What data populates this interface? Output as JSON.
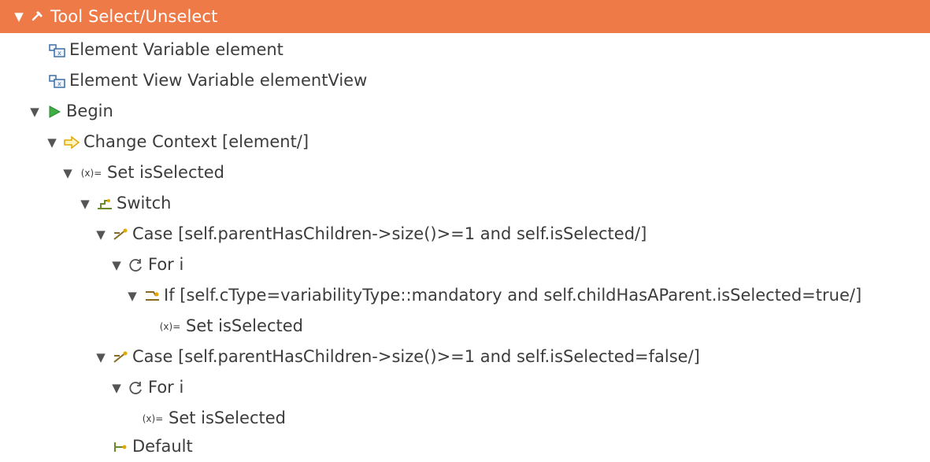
{
  "tree": {
    "root": {
      "label": "Tool Select/Unselect"
    },
    "items": [
      {
        "label": "Element Variable element"
      },
      {
        "label": "Element View Variable elementView"
      },
      {
        "label": "Begin"
      },
      {
        "label": "Change Context [element/]"
      },
      {
        "label": "Set isSelected"
      },
      {
        "label": "Switch"
      },
      {
        "label": "Case [self.parentHasChildren->size()>=1 and self.isSelected/]"
      },
      {
        "label": "For i"
      },
      {
        "label": "If [self.cType=variabilityType::mandatory and self.childHasAParent.isSelected=true/]"
      },
      {
        "label": "Set isSelected"
      },
      {
        "label": "Case [self.parentHasChildren->size()>=1 and self.isSelected=false/]"
      },
      {
        "label": "For i"
      },
      {
        "label": "Set isSelected"
      },
      {
        "label": "Default"
      }
    ]
  },
  "icons": {
    "root": "hammer-icon",
    "variable": "variable-element-icon",
    "begin": "play-icon",
    "change_context": "arrow-right-icon",
    "set": "let-assign-icon",
    "switch": "switch-icon",
    "case": "case-icon",
    "for": "loop-icon",
    "if": "if-icon",
    "default": "default-icon"
  },
  "colors": {
    "selection": "#ee7a48",
    "begin_green": "#3cb043",
    "context_yellow": "#f0c020"
  }
}
